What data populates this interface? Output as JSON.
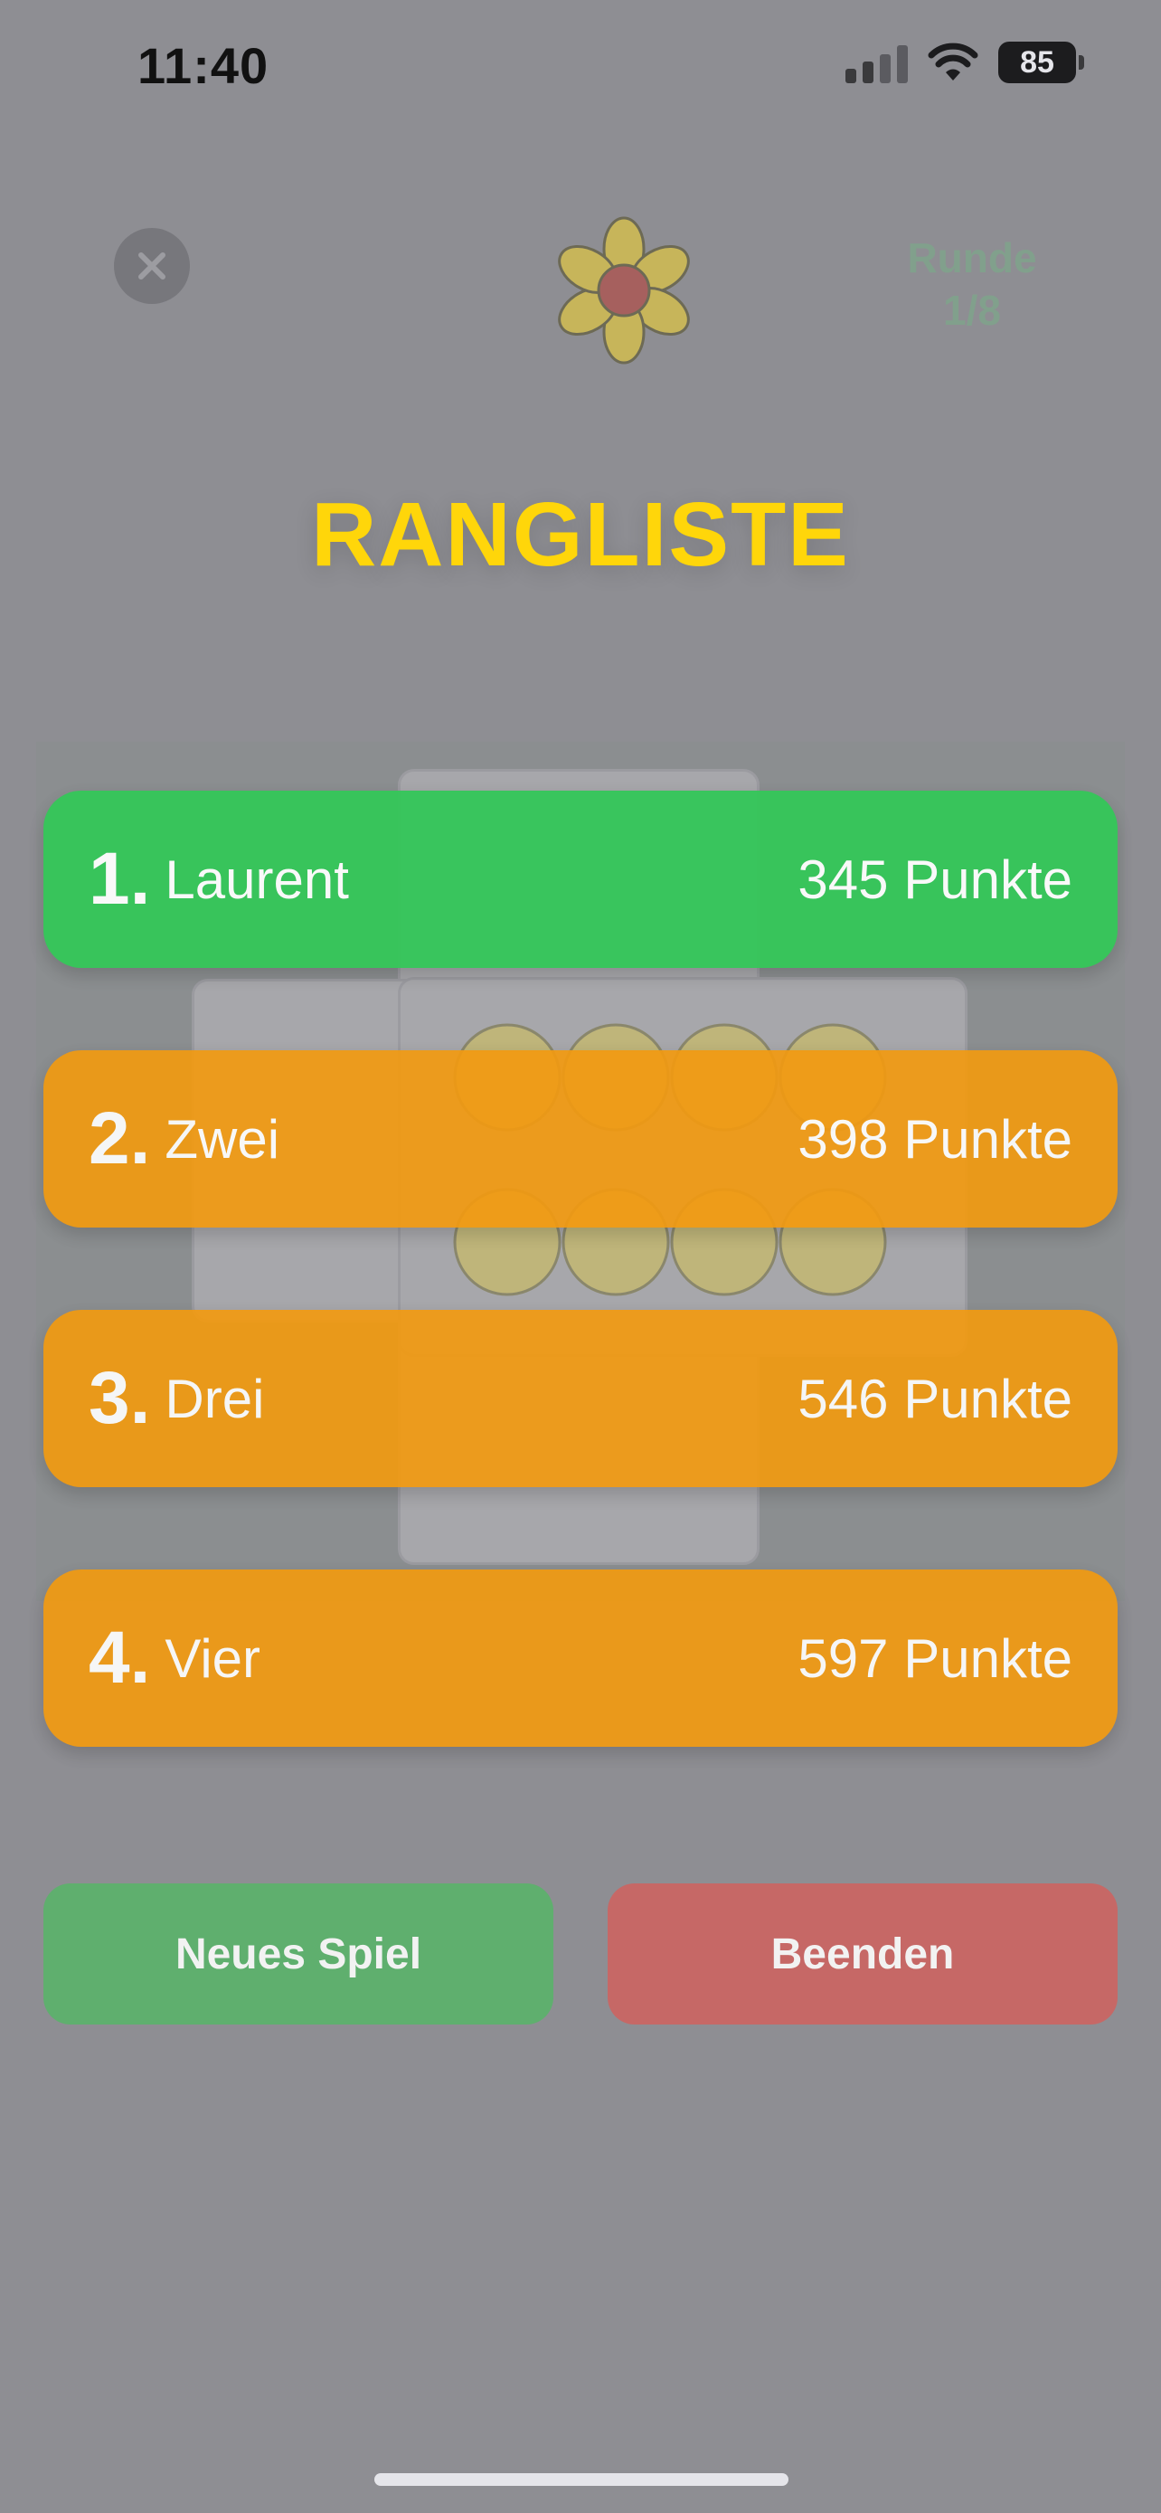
{
  "status_bar": {
    "time": "11:40",
    "battery": "85",
    "icons": [
      "cellular-signal-icon",
      "wifi-icon",
      "battery-icon"
    ]
  },
  "header": {
    "close_icon": "close-icon",
    "logo_icon": "flower-logo-icon",
    "round_label": "Runde",
    "round_value": "1/8"
  },
  "ranking": {
    "title": "RANGLISTE",
    "entries": [
      {
        "rank": "1.",
        "name": "Laurent",
        "points": "345 Punkte"
      },
      {
        "rank": "2.",
        "name": "Zwei",
        "points": "398 Punkte"
      },
      {
        "rank": "3.",
        "name": "Drei",
        "points": "546 Punkte"
      },
      {
        "rank": "4.",
        "name": "Vier",
        "points": "597 Punkte"
      }
    ]
  },
  "actions": {
    "new_game": "Neues Spiel",
    "quit": "Beenden"
  },
  "colors": {
    "title": "#ffd60a",
    "first_place": "#34c759",
    "other_place": "#f29a11",
    "new_game_button": "#5faf6e",
    "quit_button": "#c66866",
    "overlay": "#8e8e93"
  }
}
